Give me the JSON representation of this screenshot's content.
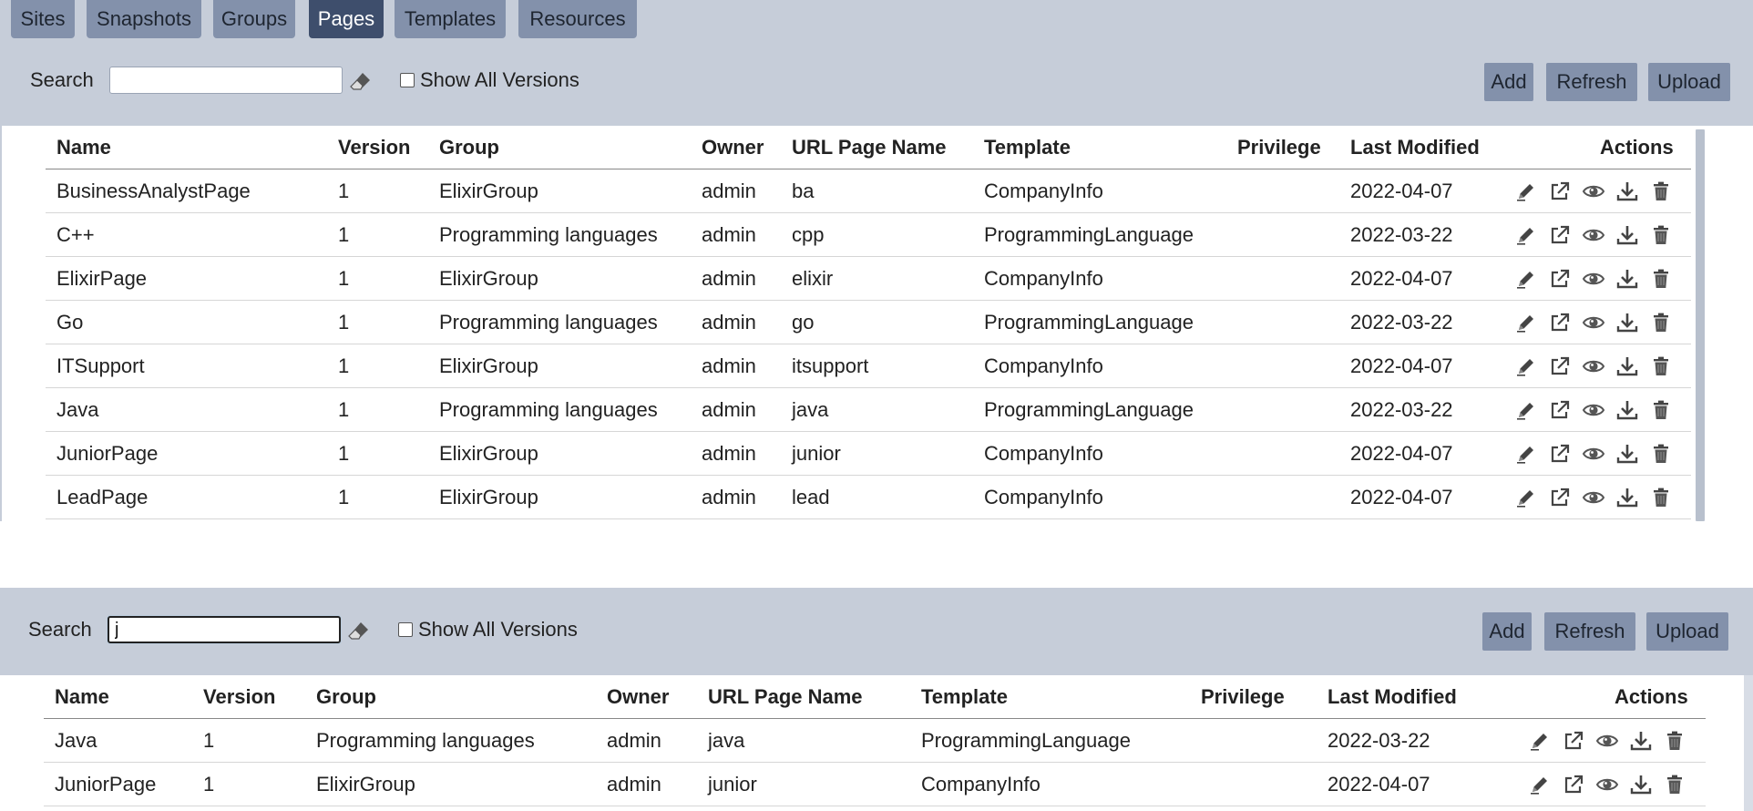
{
  "tabs": [
    {
      "label": "Sites",
      "active": false
    },
    {
      "label": "Snapshots",
      "active": false
    },
    {
      "label": "Groups",
      "active": false
    },
    {
      "label": "Pages",
      "active": true
    },
    {
      "label": "Templates",
      "active": false
    },
    {
      "label": "Resources",
      "active": false
    }
  ],
  "top": {
    "toolbar": {
      "search_label": "Search",
      "search_value": "",
      "show_all_versions_label": "Show All Versions",
      "show_all_versions_checked": false,
      "add_label": "Add",
      "refresh_label": "Refresh",
      "upload_label": "Upload"
    },
    "columns": [
      "Name",
      "Version",
      "Group",
      "Owner",
      "URL Page Name",
      "Template",
      "Privilege",
      "Last Modified",
      "Actions"
    ],
    "rows": [
      {
        "name": "BusinessAnalystPage",
        "version": "1",
        "group": "ElixirGroup",
        "owner": "admin",
        "url": "ba",
        "template": "CompanyInfo",
        "privilege": "",
        "modified": "2022-04-07"
      },
      {
        "name": "C++",
        "version": "1",
        "group": "Programming languages",
        "owner": "admin",
        "url": "cpp",
        "template": "ProgrammingLanguage",
        "privilege": "",
        "modified": "2022-03-22"
      },
      {
        "name": "ElixirPage",
        "version": "1",
        "group": "ElixirGroup",
        "owner": "admin",
        "url": "elixir",
        "template": "CompanyInfo",
        "privilege": "",
        "modified": "2022-04-07"
      },
      {
        "name": "Go",
        "version": "1",
        "group": "Programming languages",
        "owner": "admin",
        "url": "go",
        "template": "ProgrammingLanguage",
        "privilege": "",
        "modified": "2022-03-22"
      },
      {
        "name": "ITSupport",
        "version": "1",
        "group": "ElixirGroup",
        "owner": "admin",
        "url": "itsupport",
        "template": "CompanyInfo",
        "privilege": "",
        "modified": "2022-04-07"
      },
      {
        "name": "Java",
        "version": "1",
        "group": "Programming languages",
        "owner": "admin",
        "url": "java",
        "template": "ProgrammingLanguage",
        "privilege": "",
        "modified": "2022-03-22"
      },
      {
        "name": "JuniorPage",
        "version": "1",
        "group": "ElixirGroup",
        "owner": "admin",
        "url": "junior",
        "template": "CompanyInfo",
        "privilege": "",
        "modified": "2022-04-07"
      },
      {
        "name": "LeadPage",
        "version": "1",
        "group": "ElixirGroup",
        "owner": "admin",
        "url": "lead",
        "template": "CompanyInfo",
        "privilege": "",
        "modified": "2022-04-07"
      }
    ]
  },
  "bottom": {
    "toolbar": {
      "search_label": "Search",
      "search_value": "j",
      "show_all_versions_label": "Show All Versions",
      "show_all_versions_checked": false,
      "add_label": "Add",
      "refresh_label": "Refresh",
      "upload_label": "Upload"
    },
    "columns": [
      "Name",
      "Version",
      "Group",
      "Owner",
      "URL Page Name",
      "Template",
      "Privilege",
      "Last Modified",
      "Actions"
    ],
    "rows": [
      {
        "name": "Java",
        "version": "1",
        "group": "Programming languages",
        "owner": "admin",
        "url": "java",
        "template": "ProgrammingLanguage",
        "privilege": "",
        "modified": "2022-03-22"
      },
      {
        "name": "JuniorPage",
        "version": "1",
        "group": "ElixirGroup",
        "owner": "admin",
        "url": "junior",
        "template": "CompanyInfo",
        "privilege": "",
        "modified": "2022-04-07"
      }
    ]
  },
  "row_action_icons": [
    "pencil-icon",
    "external-link-icon",
    "eye-icon",
    "download-icon",
    "trash-icon"
  ],
  "colors": {
    "panel_bg": "#c6cdd9",
    "button_bg": "#8391ab",
    "active_tab_bg": "#3e4e6c"
  }
}
